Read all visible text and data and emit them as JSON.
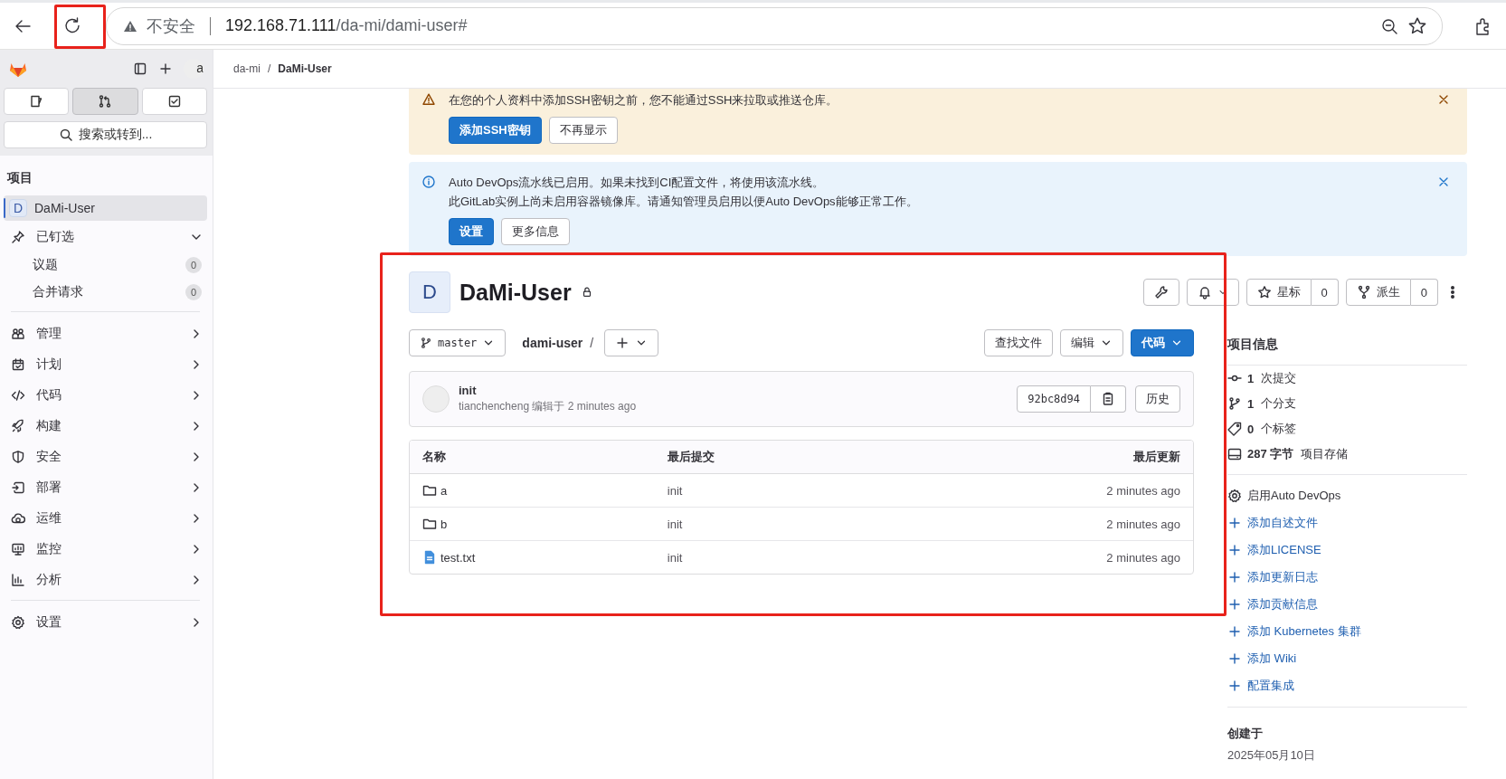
{
  "browser": {
    "security": "不安全",
    "url_host": "192.168.71.111",
    "url_path": "/da-mi/dami-user#"
  },
  "sidebar": {
    "avatar_alt": "a",
    "tabs": [
      {
        "selected": false
      },
      {
        "selected": true
      },
      {
        "selected": false
      }
    ],
    "search": "搜索或转到...",
    "section": "项目",
    "project": {
      "initial": "D",
      "name": "DaMi-User",
      "selected": true
    },
    "pinned": {
      "label": "已钉选",
      "expanded": true,
      "children": [
        {
          "label": "议题",
          "count": "0"
        },
        {
          "label": "合并请求",
          "count": "0"
        }
      ]
    },
    "groups": [
      [
        {
          "label": "管理"
        },
        {
          "label": "计划"
        },
        {
          "label": "代码"
        },
        {
          "label": "构建"
        },
        {
          "label": "安全"
        },
        {
          "label": "部署"
        },
        {
          "label": "运维"
        },
        {
          "label": "监控"
        },
        {
          "label": "分析"
        }
      ],
      [
        {
          "label": "设置"
        }
      ]
    ]
  },
  "breadcrumb": {
    "links": [
      "da-mi",
      "DaMi-User"
    ],
    "separator": "/"
  },
  "alerts": [
    {
      "kind": "warning",
      "lines": [
        "在您的个人资料中添加SSH密钥之前，您不能通过SSH来拉取或推送仓库。"
      ],
      "buttons": [
        {
          "label": "添加SSH密钥",
          "kind": "confirm"
        },
        {
          "label": "不再显示",
          "kind": "default"
        }
      ]
    },
    {
      "kind": "info",
      "lines": [
        "Auto DevOps流水线已启用。如果未找到CI配置文件，将使用该流水线。",
        "此GitLab实例上尚未启用容器镜像库。请通知管理员启用以便Auto DevOps能够正常工作。"
      ],
      "buttons": [
        {
          "label": "设置",
          "kind": "confirm"
        },
        {
          "label": "更多信息",
          "kind": "default"
        }
      ]
    }
  ],
  "project": {
    "initial": "D",
    "name": "DaMi-User",
    "private": true,
    "star": {
      "label": "星标",
      "count": "0"
    },
    "fork": {
      "label": "派生",
      "count": "0"
    }
  },
  "repo": {
    "branch": "master",
    "path": "dami-user",
    "path_sep": "/",
    "find": "查找文件",
    "edit": "编辑",
    "code": "代码"
  },
  "commit": {
    "title": "init",
    "meta": "tianchencheng 编辑于 2 minutes ago",
    "sha": "92bc8d94",
    "history": "历史"
  },
  "table": {
    "columns": [
      "名称",
      "最后提交",
      "最后更新"
    ],
    "rows": [
      {
        "kind": "folder",
        "name": "a",
        "commit": "init",
        "updated": "2 minutes ago"
      },
      {
        "kind": "folder",
        "name": "b",
        "commit": "init",
        "updated": "2 minutes ago"
      },
      {
        "kind": "file",
        "name": "test.txt",
        "commit": "init",
        "updated": "2 minutes ago"
      }
    ]
  },
  "info": {
    "title": "项目信息",
    "stats": [
      {
        "value": "1",
        "label": "次提交"
      },
      {
        "value": "1",
        "label": "个分支"
      },
      {
        "value": "0",
        "label": "个标签"
      },
      {
        "value": "287 字节",
        "label": "项目存储"
      }
    ],
    "links": [
      {
        "kind": "setting",
        "label": "启用Auto DevOps"
      },
      {
        "kind": "add",
        "label": "添加自述文件"
      },
      {
        "kind": "add",
        "label": "添加LICENSE"
      },
      {
        "kind": "add",
        "label": "添加更新日志"
      },
      {
        "kind": "add",
        "label": "添加贡献信息"
      },
      {
        "kind": "add",
        "label": "添加 Kubernetes 集群"
      },
      {
        "kind": "add",
        "label": "添加 Wiki"
      },
      {
        "kind": "add",
        "label": "配置集成"
      }
    ],
    "created": {
      "label": "创建于",
      "date": "2025年05月10日"
    }
  }
}
